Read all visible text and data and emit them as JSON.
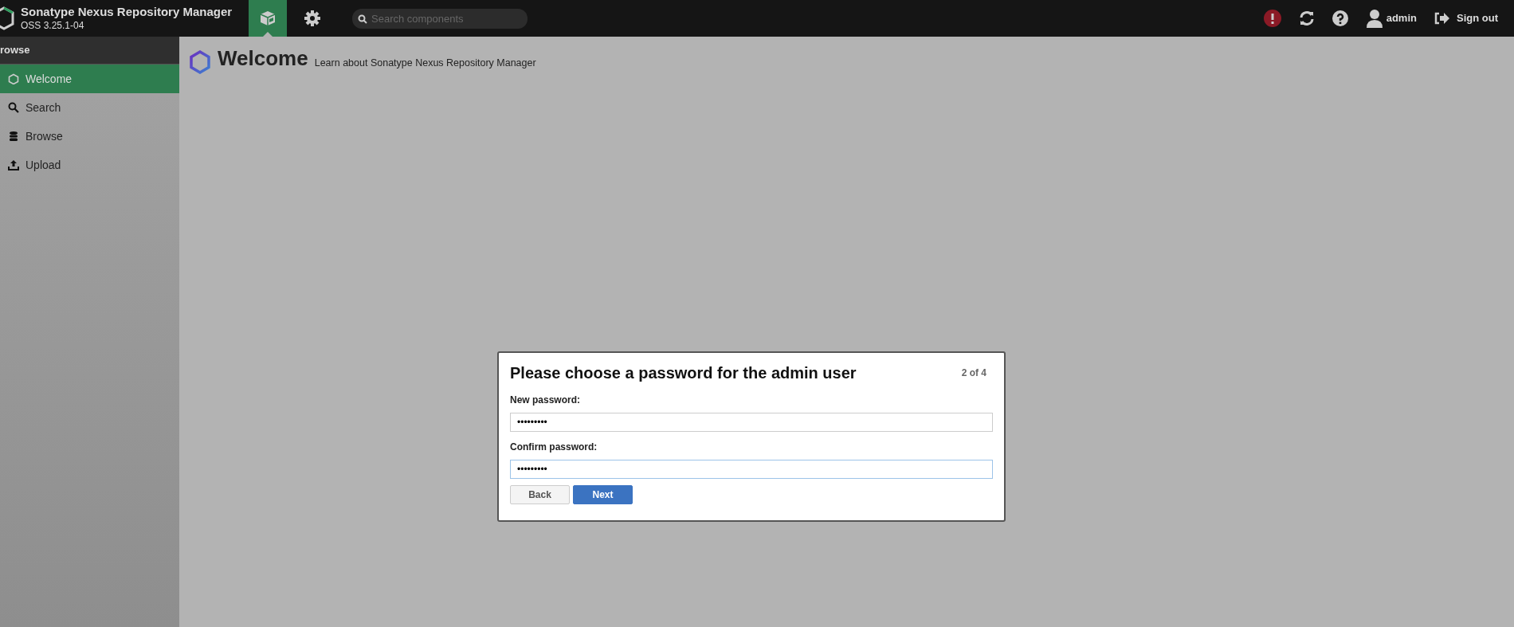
{
  "header": {
    "title": "Sonatype Nexus Repository Manager",
    "version": "OSS 3.25.1-04",
    "modes": [
      {
        "kind": "browse",
        "selected": true
      },
      {
        "kind": "admin",
        "selected": false
      }
    ],
    "search": {
      "placeholder": "Search components"
    },
    "user": "admin",
    "sign_out": "Sign out"
  },
  "sidebar": {
    "title": "rowse",
    "items": [
      {
        "kind": "welcome",
        "label": "Welcome",
        "selected": true
      },
      {
        "kind": "search",
        "label": "Search",
        "selected": false
      },
      {
        "kind": "browse",
        "label": "Browse",
        "selected": false
      },
      {
        "kind": "upload",
        "label": "Upload",
        "selected": false
      }
    ]
  },
  "page": {
    "title": "Welcome",
    "subtitle": "Learn about Sonatype Nexus Repository Manager"
  },
  "dialog": {
    "title": "Please choose a password for the admin user",
    "step": "2 of 4",
    "fields": [
      {
        "label": "New password:",
        "value": "•••••••••",
        "focused": false
      },
      {
        "label": "Confirm password:",
        "value": "•••••••••",
        "focused": true
      }
    ],
    "buttons": [
      {
        "kind": "secondary",
        "label": "Back"
      },
      {
        "kind": "primary",
        "label": "Next"
      }
    ]
  }
}
